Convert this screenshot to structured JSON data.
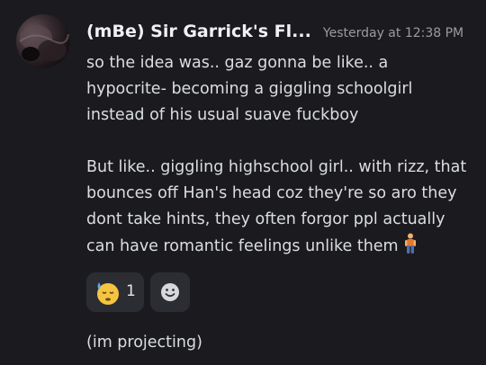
{
  "message": {
    "author": "(mBe) Sir Garrick's Fl...",
    "timestamp": "Yesterday at 12:38 PM",
    "paragraph1": [
      "so the idea was.. gaz gonna be like.. a",
      "hypocrite- becoming a giggling schoolgirl",
      "instead of his usual suave fuckboy"
    ],
    "paragraph2": [
      "But like.. giggling highschool girl.. with rizz, that",
      "bounces off Han's head coz they're so aro they",
      "dont take hints, they often forgor ppl actually",
      "can have romantic feelings unlike them"
    ],
    "inline_emoji": "person-standing-emoji"
  },
  "reactions": [
    {
      "emoji": "sleepy-sweat-face-emoji",
      "count": "1"
    }
  ],
  "add_reaction_icon": "add-reaction-smiley-icon",
  "followup": "(im projecting)",
  "colors": {
    "background": "#1b1b1f",
    "text": "#dbdee1",
    "username": "#f0f1f3",
    "timestamp": "#9a9ca2",
    "reaction_bg": "#2b2d33"
  }
}
